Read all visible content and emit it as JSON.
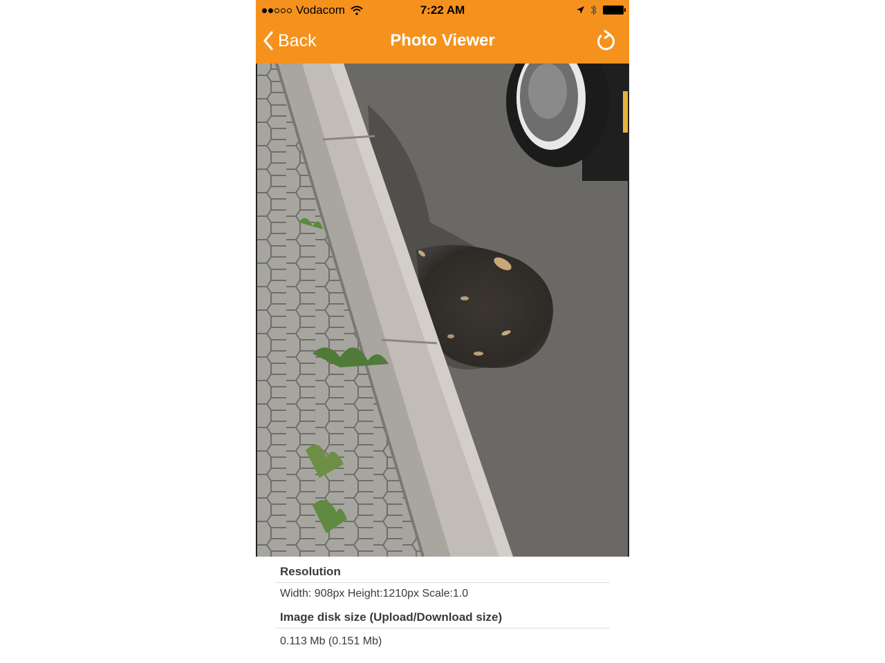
{
  "status_bar": {
    "carrier": "Vodacom",
    "signal_bars_filled": 2,
    "signal_bars_total": 5,
    "time": "7:22 AM"
  },
  "nav": {
    "back_label": "Back",
    "title": "Photo Viewer"
  },
  "photo": {
    "alt": "Pothole in road next to curb"
  },
  "info": {
    "resolution_header": "Resolution",
    "resolution_value": "Width: 908px Height:1210px Scale:1.0",
    "disk_size_header": "Image disk size (Upload/Download size)",
    "disk_size_value": "0.113 Mb (0.151 Mb)"
  },
  "colors": {
    "accent": "#f5921e",
    "text": "#3a3a3a"
  }
}
